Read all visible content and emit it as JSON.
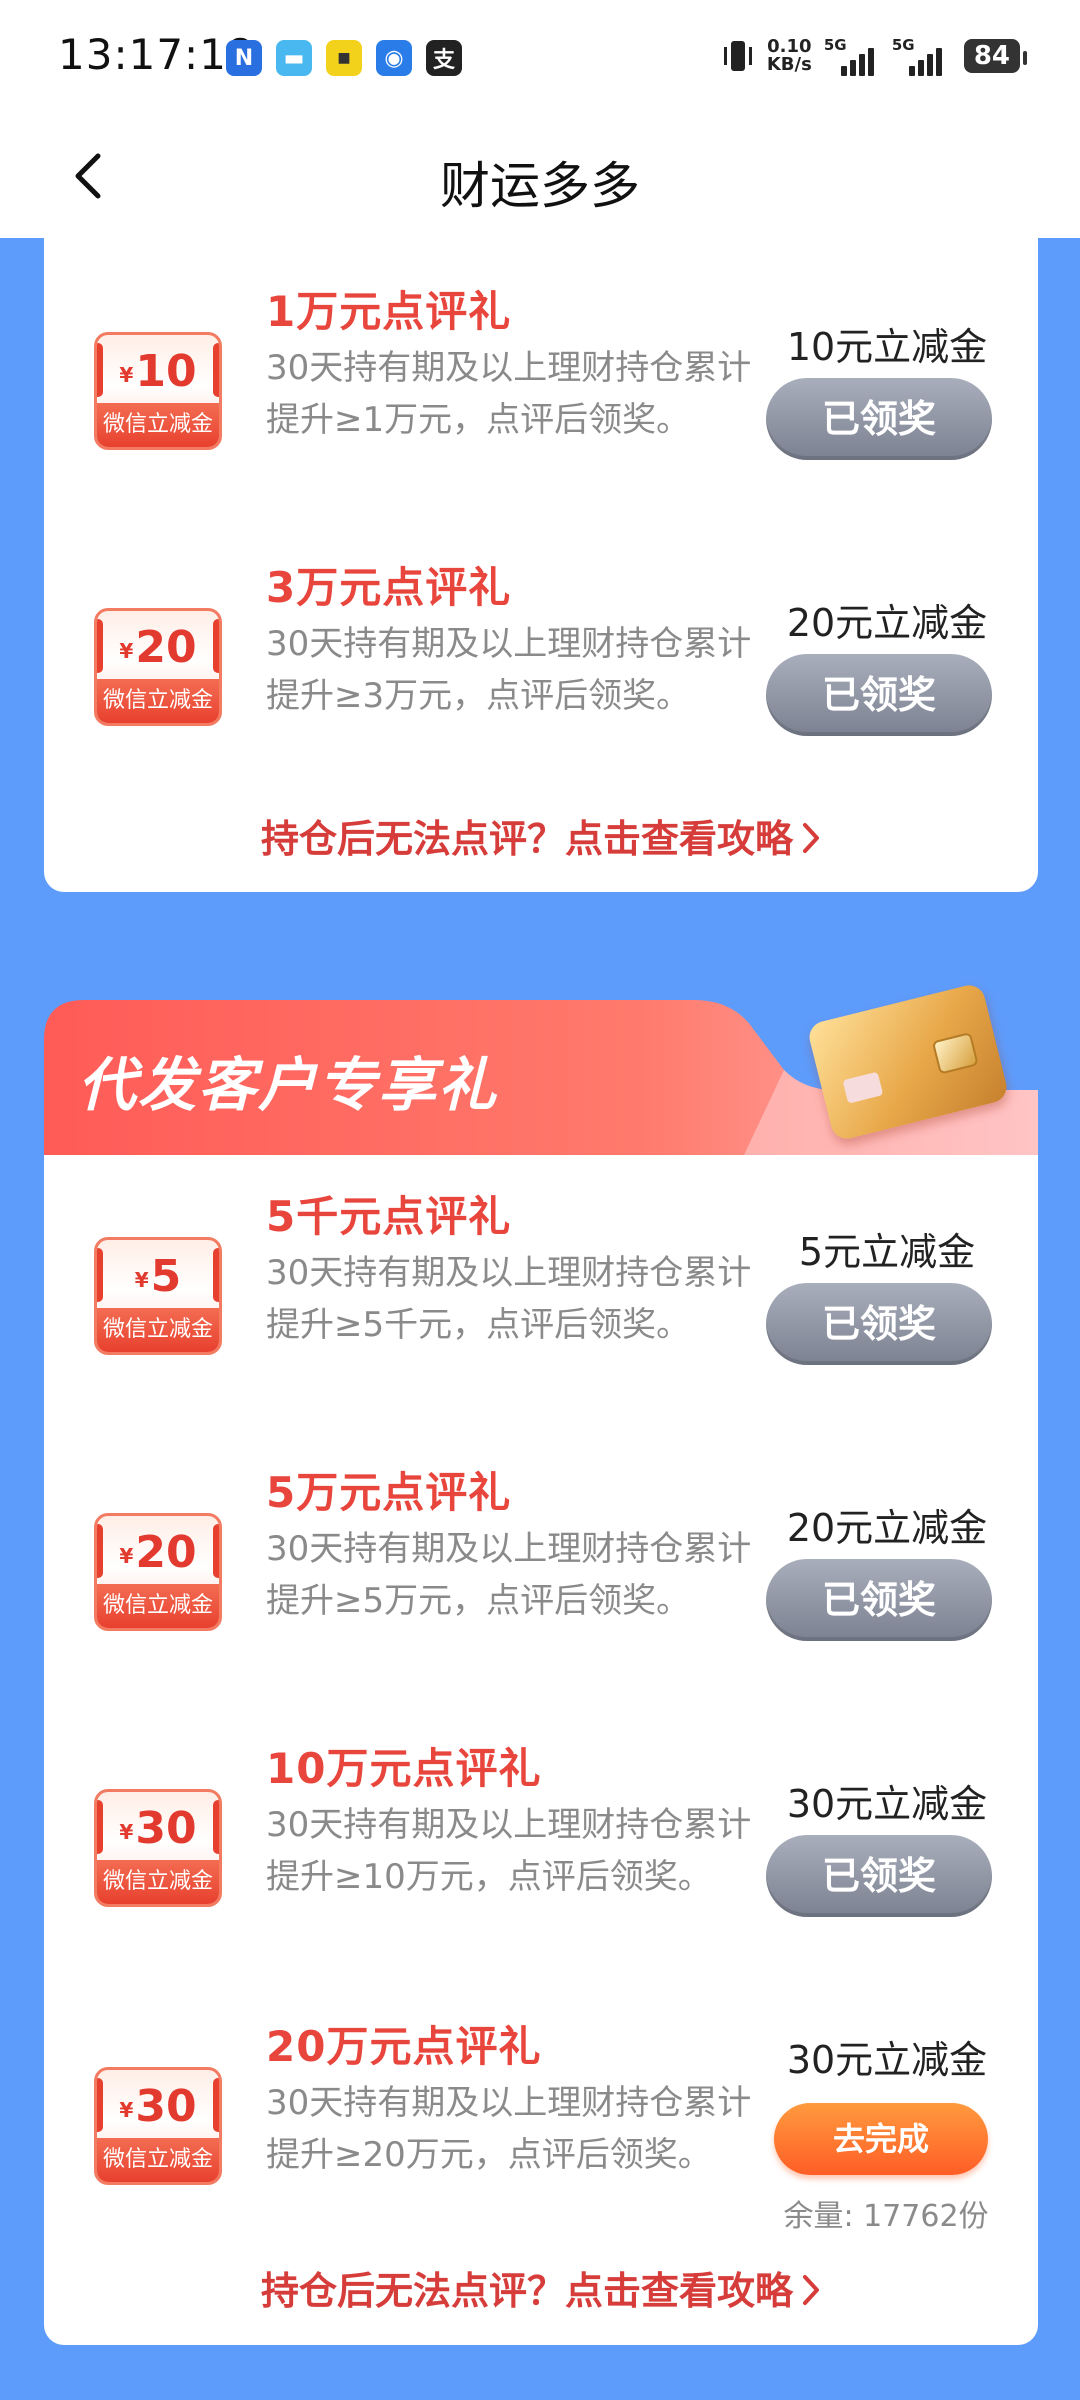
{
  "status_bar": {
    "time": "13:17:18",
    "net_speed_value": "0.10",
    "net_speed_unit": "KB/s",
    "signal1_label": "5G",
    "signal2_label": "5G",
    "battery": "84"
  },
  "nav": {
    "title": "财运多多"
  },
  "section1": {
    "items": [
      {
        "amount": "10",
        "badge_label": "微信立减金",
        "title": "1万元点评礼",
        "desc": "30天持有期及以上理财持仓累计提升≥1万元，点评后领奖。",
        "reward": "10元立减金",
        "button": "已领奖"
      },
      {
        "amount": "20",
        "badge_label": "微信立减金",
        "title": "3万元点评礼",
        "desc": "30天持有期及以上理财持仓累计提升≥3万元，点评后领奖。",
        "reward": "20元立减金",
        "button": "已领奖"
      }
    ],
    "guide": "持仓后无法点评？点击查看攻略"
  },
  "section2": {
    "title": "代发客户专享礼",
    "items": [
      {
        "amount": "5",
        "badge_label": "微信立减金",
        "title": "5千元点评礼",
        "desc": "30天持有期及以上理财持仓累计提升≥5千元，点评后领奖。",
        "reward": "5元立减金",
        "button": "已领奖"
      },
      {
        "amount": "20",
        "badge_label": "微信立减金",
        "title": "5万元点评礼",
        "desc": "30天持有期及以上理财持仓累计提升≥5万元，点评后领奖。",
        "reward": "20元立减金",
        "button": "已领奖"
      },
      {
        "amount": "30",
        "badge_label": "微信立减金",
        "title": "10万元点评礼",
        "desc": "30天持有期及以上理财持仓累计提升≥10万元，点评后领奖。",
        "reward": "30元立减金",
        "button": "已领奖"
      },
      {
        "amount": "30",
        "badge_label": "微信立减金",
        "title": "20万元点评礼",
        "desc": "30天持有期及以上理财持仓累计提升≥20万元，点评后领奖。",
        "reward": "30元立减金",
        "button": "去完成",
        "remaining": "余量: 17762份"
      }
    ],
    "guide": "持仓后无法点评？点击查看攻略"
  },
  "colors": {
    "background": "#5e9cfb",
    "title_red": "#e8453c",
    "ribbon": "#ff6f61"
  },
  "coupon_yen": "¥"
}
